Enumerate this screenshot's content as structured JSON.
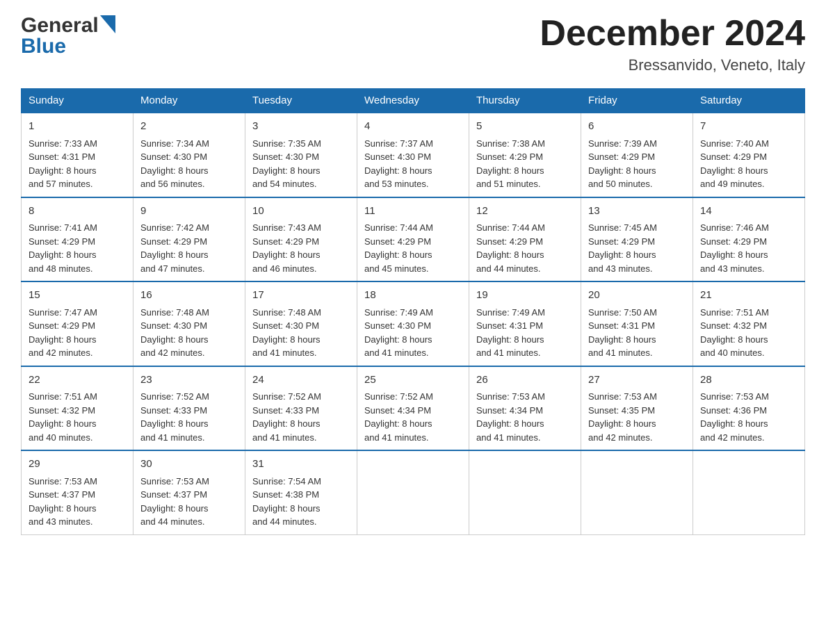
{
  "header": {
    "logo_general": "General",
    "logo_blue": "Blue",
    "month_title": "December 2024",
    "location": "Bressanvido, Veneto, Italy"
  },
  "days_of_week": [
    "Sunday",
    "Monday",
    "Tuesday",
    "Wednesday",
    "Thursday",
    "Friday",
    "Saturday"
  ],
  "weeks": [
    [
      {
        "day": "1",
        "sunrise": "7:33 AM",
        "sunset": "4:31 PM",
        "daylight_h": "8",
        "daylight_m": "57"
      },
      {
        "day": "2",
        "sunrise": "7:34 AM",
        "sunset": "4:30 PM",
        "daylight_h": "8",
        "daylight_m": "56"
      },
      {
        "day": "3",
        "sunrise": "7:35 AM",
        "sunset": "4:30 PM",
        "daylight_h": "8",
        "daylight_m": "54"
      },
      {
        "day": "4",
        "sunrise": "7:37 AM",
        "sunset": "4:30 PM",
        "daylight_h": "8",
        "daylight_m": "53"
      },
      {
        "day": "5",
        "sunrise": "7:38 AM",
        "sunset": "4:29 PM",
        "daylight_h": "8",
        "daylight_m": "51"
      },
      {
        "day": "6",
        "sunrise": "7:39 AM",
        "sunset": "4:29 PM",
        "daylight_h": "8",
        "daylight_m": "50"
      },
      {
        "day": "7",
        "sunrise": "7:40 AM",
        "sunset": "4:29 PM",
        "daylight_h": "8",
        "daylight_m": "49"
      }
    ],
    [
      {
        "day": "8",
        "sunrise": "7:41 AM",
        "sunset": "4:29 PM",
        "daylight_h": "8",
        "daylight_m": "48"
      },
      {
        "day": "9",
        "sunrise": "7:42 AM",
        "sunset": "4:29 PM",
        "daylight_h": "8",
        "daylight_m": "47"
      },
      {
        "day": "10",
        "sunrise": "7:43 AM",
        "sunset": "4:29 PM",
        "daylight_h": "8",
        "daylight_m": "46"
      },
      {
        "day": "11",
        "sunrise": "7:44 AM",
        "sunset": "4:29 PM",
        "daylight_h": "8",
        "daylight_m": "45"
      },
      {
        "day": "12",
        "sunrise": "7:44 AM",
        "sunset": "4:29 PM",
        "daylight_h": "8",
        "daylight_m": "44"
      },
      {
        "day": "13",
        "sunrise": "7:45 AM",
        "sunset": "4:29 PM",
        "daylight_h": "8",
        "daylight_m": "43"
      },
      {
        "day": "14",
        "sunrise": "7:46 AM",
        "sunset": "4:29 PM",
        "daylight_h": "8",
        "daylight_m": "43"
      }
    ],
    [
      {
        "day": "15",
        "sunrise": "7:47 AM",
        "sunset": "4:29 PM",
        "daylight_h": "8",
        "daylight_m": "42"
      },
      {
        "day": "16",
        "sunrise": "7:48 AM",
        "sunset": "4:30 PM",
        "daylight_h": "8",
        "daylight_m": "42"
      },
      {
        "day": "17",
        "sunrise": "7:48 AM",
        "sunset": "4:30 PM",
        "daylight_h": "8",
        "daylight_m": "41"
      },
      {
        "day": "18",
        "sunrise": "7:49 AM",
        "sunset": "4:30 PM",
        "daylight_h": "8",
        "daylight_m": "41"
      },
      {
        "day": "19",
        "sunrise": "7:49 AM",
        "sunset": "4:31 PM",
        "daylight_h": "8",
        "daylight_m": "41"
      },
      {
        "day": "20",
        "sunrise": "7:50 AM",
        "sunset": "4:31 PM",
        "daylight_h": "8",
        "daylight_m": "41"
      },
      {
        "day": "21",
        "sunrise": "7:51 AM",
        "sunset": "4:32 PM",
        "daylight_h": "8",
        "daylight_m": "40"
      }
    ],
    [
      {
        "day": "22",
        "sunrise": "7:51 AM",
        "sunset": "4:32 PM",
        "daylight_h": "8",
        "daylight_m": "40"
      },
      {
        "day": "23",
        "sunrise": "7:52 AM",
        "sunset": "4:33 PM",
        "daylight_h": "8",
        "daylight_m": "41"
      },
      {
        "day": "24",
        "sunrise": "7:52 AM",
        "sunset": "4:33 PM",
        "daylight_h": "8",
        "daylight_m": "41"
      },
      {
        "day": "25",
        "sunrise": "7:52 AM",
        "sunset": "4:34 PM",
        "daylight_h": "8",
        "daylight_m": "41"
      },
      {
        "day": "26",
        "sunrise": "7:53 AM",
        "sunset": "4:34 PM",
        "daylight_h": "8",
        "daylight_m": "41"
      },
      {
        "day": "27",
        "sunrise": "7:53 AM",
        "sunset": "4:35 PM",
        "daylight_h": "8",
        "daylight_m": "42"
      },
      {
        "day": "28",
        "sunrise": "7:53 AM",
        "sunset": "4:36 PM",
        "daylight_h": "8",
        "daylight_m": "42"
      }
    ],
    [
      {
        "day": "29",
        "sunrise": "7:53 AM",
        "sunset": "4:37 PM",
        "daylight_h": "8",
        "daylight_m": "43"
      },
      {
        "day": "30",
        "sunrise": "7:53 AM",
        "sunset": "4:37 PM",
        "daylight_h": "8",
        "daylight_m": "44"
      },
      {
        "day": "31",
        "sunrise": "7:54 AM",
        "sunset": "4:38 PM",
        "daylight_h": "8",
        "daylight_m": "44"
      },
      null,
      null,
      null,
      null
    ]
  ],
  "labels": {
    "sunrise": "Sunrise:",
    "sunset": "Sunset:",
    "daylight": "Daylight:",
    "daylight_and": "and",
    "daylight_hours": "hours",
    "daylight_minutes": "minutes."
  }
}
